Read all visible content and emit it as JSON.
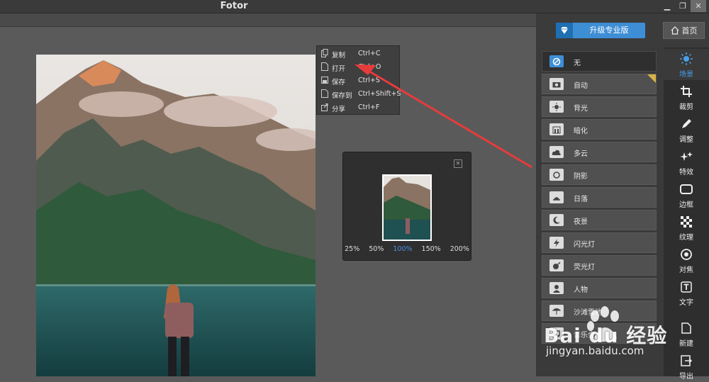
{
  "window": {
    "title": "Fotor",
    "min": "▁",
    "restore": "❐",
    "close": "✕"
  },
  "header": {
    "upgrade_label": "升级专业版",
    "home_label": "首页"
  },
  "context_menu": {
    "items": [
      {
        "label": "复制",
        "shortcut": "Ctrl+C",
        "icon": "copy-icon"
      },
      {
        "label": "打开",
        "shortcut": "Ctrl+O",
        "icon": "file-icon"
      },
      {
        "label": "保存",
        "shortcut": "Ctrl+S",
        "icon": "save-icon"
      },
      {
        "label": "保存到",
        "shortcut": "Ctrl+Shift+S",
        "icon": "save-as-icon"
      },
      {
        "label": "分享",
        "shortcut": "Ctrl+F",
        "icon": "share-icon"
      }
    ]
  },
  "navigator": {
    "zoom_levels": [
      "25%",
      "50%",
      "100%",
      "150%",
      "200%"
    ],
    "active_zoom": "100%"
  },
  "scene_panel": {
    "items": [
      {
        "label": "无",
        "icon": "none-icon",
        "active": true
      },
      {
        "label": "自动",
        "icon": "camera-icon",
        "premium": true
      },
      {
        "label": "背光",
        "icon": "backlight-icon"
      },
      {
        "label": "暗化",
        "icon": "darken-icon"
      },
      {
        "label": "多云",
        "icon": "cloud-icon"
      },
      {
        "label": "阴影",
        "icon": "shadow-icon"
      },
      {
        "label": "日落",
        "icon": "sunset-icon"
      },
      {
        "label": "夜景",
        "icon": "moon-icon"
      },
      {
        "label": "闪光灯",
        "icon": "flash-icon"
      },
      {
        "label": "荧光灯",
        "icon": "fluorescent-icon"
      },
      {
        "label": "人物",
        "icon": "portrait-icon"
      },
      {
        "label": "沙滩雪地",
        "icon": "beach-icon"
      },
      {
        "label": "音乐会",
        "icon": "concert-icon"
      }
    ]
  },
  "tools": [
    {
      "label": "场景",
      "icon": "sun-icon",
      "active": true
    },
    {
      "label": "裁剪",
      "icon": "crop-icon"
    },
    {
      "label": "调整",
      "icon": "pencil-icon"
    },
    {
      "label": "特效",
      "icon": "sparkle-icon"
    },
    {
      "label": "边框",
      "icon": "frame-icon"
    },
    {
      "label": "纹理",
      "icon": "texture-icon"
    },
    {
      "label": "对焦",
      "icon": "focus-icon"
    },
    {
      "label": "文字",
      "icon": "text-icon"
    },
    {
      "label": "新建",
      "icon": "new-icon"
    },
    {
      "label": "导出",
      "icon": "export-icon"
    }
  ],
  "watermark": {
    "brand": "Bai du 经验",
    "url": "jingyan.baidu.com"
  },
  "colors": {
    "accent": "#3e8ed6",
    "active_zoom": "#4a8fe0",
    "arrow": "#e83b3b",
    "premium": "#d7b349"
  }
}
